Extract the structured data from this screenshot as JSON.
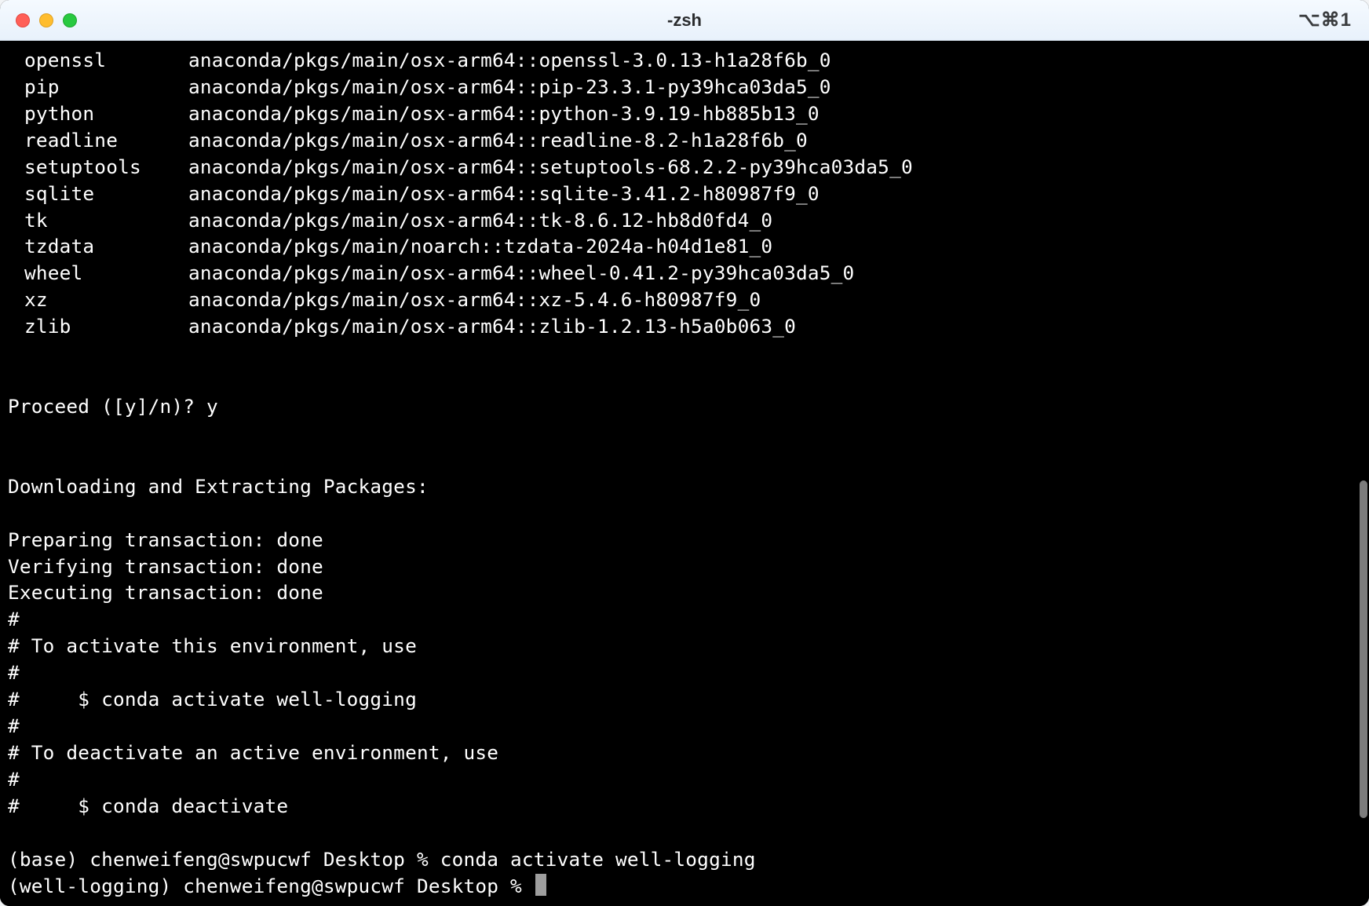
{
  "window": {
    "title": "-zsh",
    "shortcut": "⌥⌘1"
  },
  "packages": [
    {
      "name": "openssl",
      "spec": "anaconda/pkgs/main/osx-arm64::openssl-3.0.13-h1a28f6b_0"
    },
    {
      "name": "pip",
      "spec": "anaconda/pkgs/main/osx-arm64::pip-23.3.1-py39hca03da5_0"
    },
    {
      "name": "python",
      "spec": "anaconda/pkgs/main/osx-arm64::python-3.9.19-hb885b13_0"
    },
    {
      "name": "readline",
      "spec": "anaconda/pkgs/main/osx-arm64::readline-8.2-h1a28f6b_0"
    },
    {
      "name": "setuptools",
      "spec": "anaconda/pkgs/main/osx-arm64::setuptools-68.2.2-py39hca03da5_0"
    },
    {
      "name": "sqlite",
      "spec": "anaconda/pkgs/main/osx-arm64::sqlite-3.41.2-h80987f9_0"
    },
    {
      "name": "tk",
      "spec": "anaconda/pkgs/main/osx-arm64::tk-8.6.12-hb8d0fd4_0"
    },
    {
      "name": "tzdata",
      "spec": "anaconda/pkgs/main/noarch::tzdata-2024a-h04d1e81_0"
    },
    {
      "name": "wheel",
      "spec": "anaconda/pkgs/main/osx-arm64::wheel-0.41.2-py39hca03da5_0"
    },
    {
      "name": "xz",
      "spec": "anaconda/pkgs/main/osx-arm64::xz-5.4.6-h80987f9_0"
    },
    {
      "name": "zlib",
      "spec": "anaconda/pkgs/main/osx-arm64::zlib-1.2.13-h5a0b063_0"
    }
  ],
  "lines": {
    "proceed": "Proceed ([y]/n)? y",
    "download": "Downloading and Extracting Packages:",
    "prepare": "Preparing transaction: done",
    "verify": "Verifying transaction: done",
    "execute": "Executing transaction: done",
    "c1": "#",
    "c2": "# To activate this environment, use",
    "c3": "#",
    "c4": "#     $ conda activate well-logging",
    "c5": "#",
    "c6": "# To deactivate an active environment, use",
    "c7": "#",
    "c8": "#     $ conda deactivate",
    "prompt1": "(base) chenweifeng@swpucwf Desktop % conda activate well-logging",
    "prompt2": "(well-logging) chenweifeng@swpucwf Desktop % "
  }
}
